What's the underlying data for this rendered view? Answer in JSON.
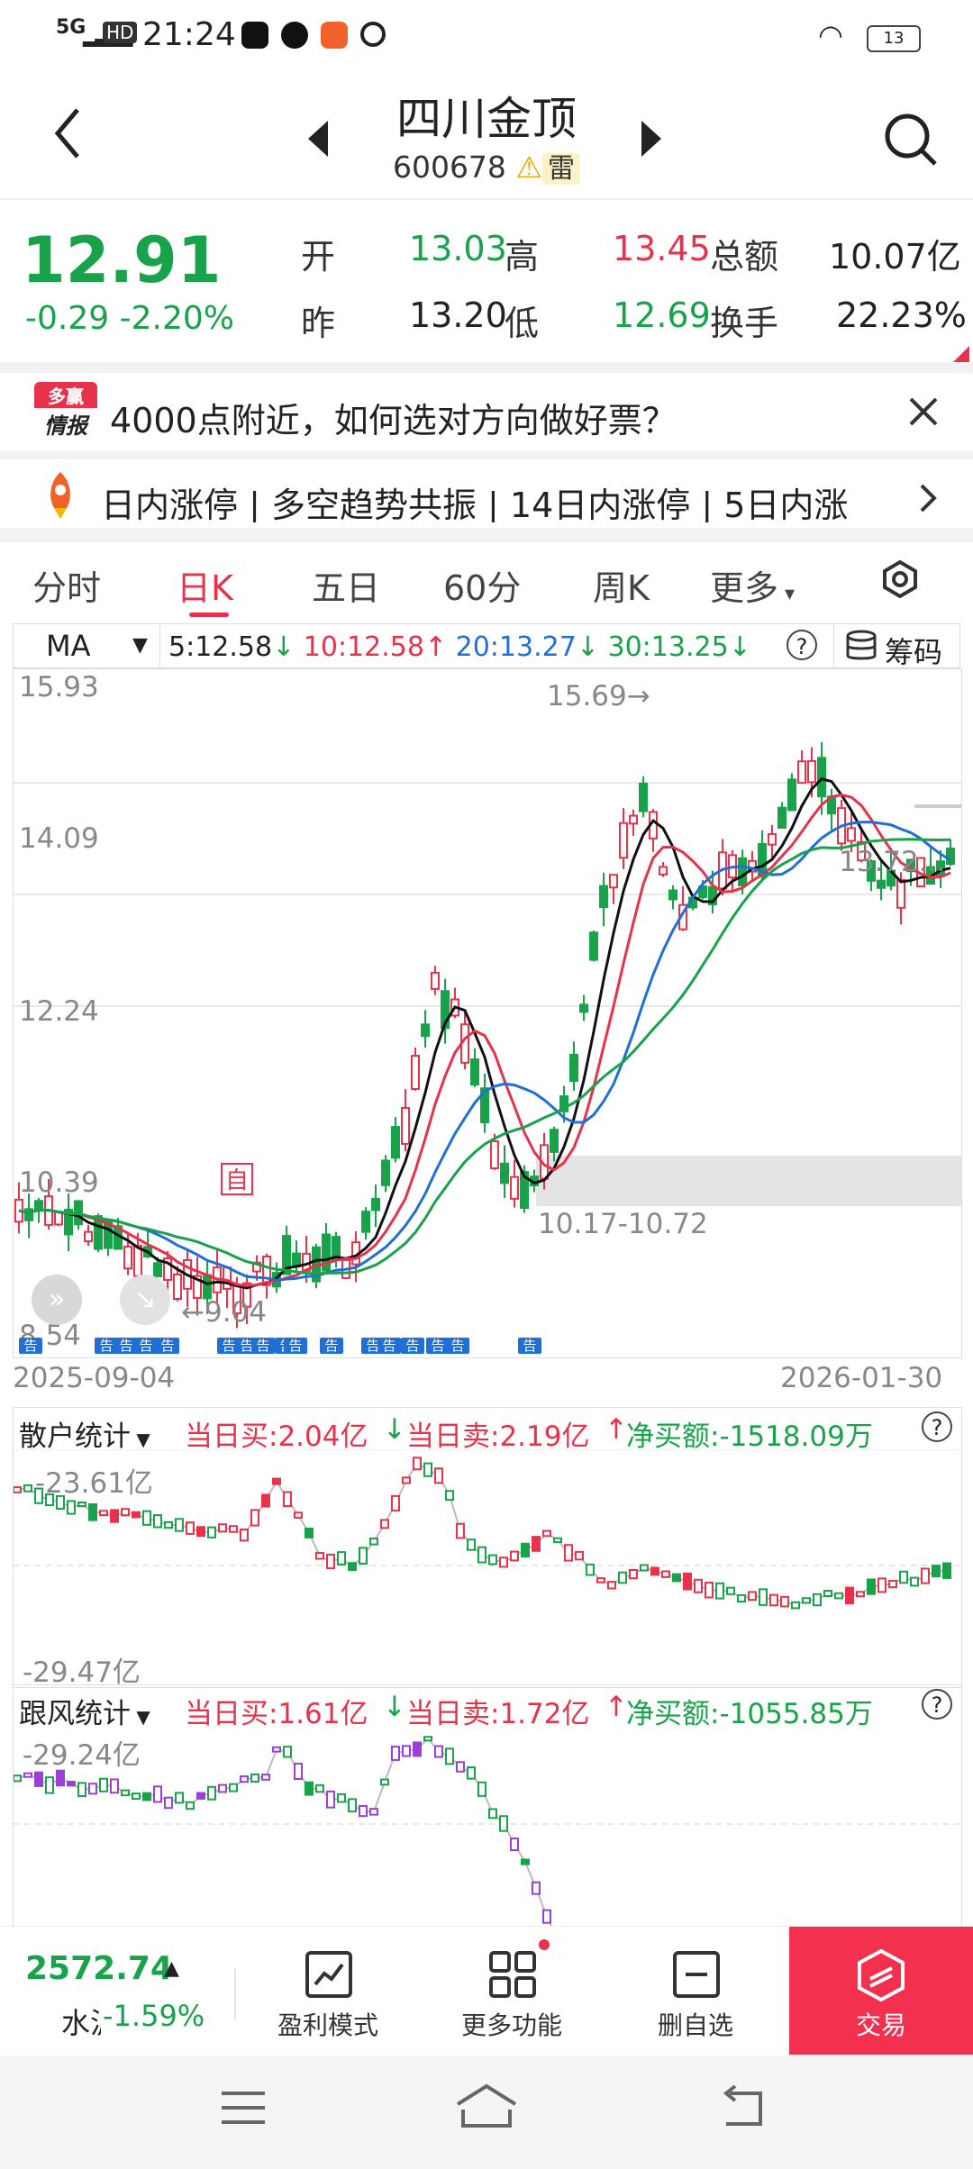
{
  "status": {
    "network": "5G",
    "hd": "HD",
    "time": "21:24",
    "battery": "13"
  },
  "header": {
    "name": "四川金顶",
    "code": "600678",
    "risk_tag": "雷"
  },
  "quote": {
    "price": "12.91",
    "change": "-0.29",
    "pct": "-2.20%",
    "open_label": "开",
    "open": "13.03",
    "high_label": "高",
    "high": "13.45",
    "prev_label": "昨",
    "prev": "13.20",
    "low_label": "低",
    "low": "12.69",
    "amount_label": "总额",
    "amount": "10.07亿",
    "turnover_label": "换手",
    "turnover": "22.23%"
  },
  "banner": {
    "logo_top": "多赢",
    "logo_bottom": "情报",
    "text": "4000点附近，如何选对方向做好票？"
  },
  "ticker": {
    "text": "日内涨停 | 多空趋势共振 | 14日内涨停 | 5日内涨"
  },
  "tabs": [
    {
      "label": "分时"
    },
    {
      "label": "日K"
    },
    {
      "label": "五日"
    },
    {
      "label": "60分"
    },
    {
      "label": "周K"
    },
    {
      "label": "更多"
    }
  ],
  "ma": {
    "selector": "MA",
    "ma5": "5:12.58",
    "ma10": "10:12.58",
    "ma20": "20:13.27",
    "ma30": "30:13.25",
    "chip": "筹码"
  },
  "kline": {
    "y_labels": [
      "15.93",
      "14.09",
      "12.24",
      "10.39",
      "8.54"
    ],
    "max_label": "15.69",
    "min_label": "9.04",
    "zone_label": "10.17-10.72",
    "right_label": "13.72...",
    "marker_self": "自",
    "gao": "告",
    "date_start": "2025-09-04",
    "date_end": "2026-01-30"
  },
  "retail": {
    "title": "散户统计",
    "buy": "当日买:2.04亿",
    "sell": "当日卖:2.19亿",
    "net": "净买额:-1518.09万",
    "top": "-23.61亿",
    "bottom": "-29.47亿"
  },
  "follow": {
    "title": "跟风统计",
    "buy": "当日买:1.61亿",
    "sell": "当日卖:1.72亿",
    "net": "净买额:-1055.85万",
    "top": "-29.24亿"
  },
  "bottom": {
    "index_value": "2572.74",
    "index_name": "水泥",
    "index_pct": "-1.59%",
    "profit": "盈利模式",
    "more": "更多功能",
    "del": "删自选",
    "trade": "交易"
  },
  "chart_data": {
    "type": "candlestick",
    "ylim": [
      8.54,
      15.93
    ],
    "x_range": [
      "2025-09-04",
      "2026-01-30"
    ],
    "ma": {
      "MA5": 12.58,
      "MA10": 12.58,
      "MA20": 13.27,
      "MA30": 13.25
    },
    "annotated_high": 15.69,
    "annotated_low": 9.04,
    "last_close": 12.91
  }
}
